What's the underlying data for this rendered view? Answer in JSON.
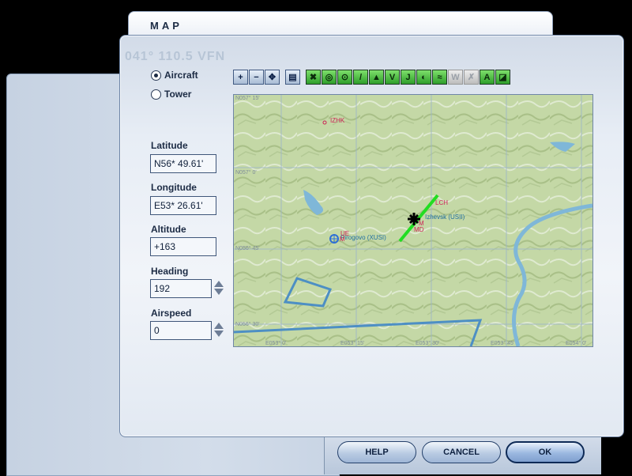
{
  "window": {
    "title": "MAP",
    "background_text": "041° 110.5 VFN"
  },
  "mode_radios": [
    {
      "label": "Aircraft",
      "selected": true
    },
    {
      "label": "Tower",
      "selected": false
    }
  ],
  "fields": {
    "latitude": {
      "label": "Latitude",
      "value": "N56* 49.61'"
    },
    "longitude": {
      "label": "Longitude",
      "value": "E53* 26.61'"
    },
    "altitude": {
      "label": "Altitude",
      "value": "+163"
    },
    "heading": {
      "label": "Heading",
      "value": "192"
    },
    "airspeed": {
      "label": "Airspeed",
      "value": "0"
    }
  },
  "toolbar": [
    {
      "icon": "zoom-in-icon",
      "glyph": "+"
    },
    {
      "icon": "zoom-out-icon",
      "glyph": "−"
    },
    {
      "icon": "center-aircraft-icon",
      "glyph": "✥"
    },
    {
      "icon": "document-icon",
      "glyph": "▤"
    },
    {
      "icon": "show-airports-icon",
      "glyph": "✖"
    },
    {
      "icon": "show-vor-icon",
      "glyph": "◎"
    },
    {
      "icon": "show-ndb-icon",
      "glyph": "⊙"
    },
    {
      "icon": "show-ils-icon",
      "glyph": "/"
    },
    {
      "icon": "show-intersections-icon",
      "glyph": "▲"
    },
    {
      "icon": "show-victor-airways-icon",
      "glyph": "V"
    },
    {
      "icon": "show-jet-airways-icon",
      "glyph": "J"
    },
    {
      "icon": "show-compass-icon",
      "glyph": "◐"
    },
    {
      "icon": "show-route-icon",
      "glyph": "≈"
    },
    {
      "icon": "show-weather-icon",
      "glyph": "W"
    },
    {
      "icon": "disabled-icon",
      "glyph": "✗"
    },
    {
      "icon": "show-labels-icon",
      "glyph": "A"
    },
    {
      "icon": "show-terrain-icon",
      "glyph": "◪"
    }
  ],
  "map": {
    "grid_labels": {
      "lat": [
        "N057° 15'",
        "N057° 0'",
        "N056° 45'",
        "N056° 30'"
      ],
      "lon": [
        "E053° 0'",
        "E053° 15'",
        "E053° 30'",
        "E053° 45'",
        "E054° 0'"
      ]
    },
    "airports": [
      {
        "id": "IZHK"
      },
      {
        "name": "Izhevsk (USII)"
      },
      {
        "name": "Pirogovo (XUSI)"
      }
    ],
    "ils_labels": [
      "LCH",
      "M",
      "MD",
      "UE",
      "M"
    ],
    "colors": {
      "terrain": "#c4d8a6",
      "water": "#7fb7d8",
      "border": "#4d8fc4",
      "runway": "#22dd22",
      "label": "#cc2255",
      "airport_label": "#1f6ea0"
    }
  },
  "buttons": {
    "help": "HELP",
    "cancel": "CANCEL",
    "ok": "OK"
  }
}
